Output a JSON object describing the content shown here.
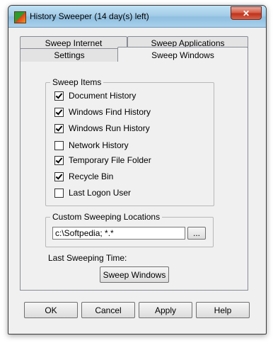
{
  "window": {
    "title": "History Sweeper (14 day(s) left)",
    "close_label": "✕"
  },
  "tabs": {
    "row1": [
      "Sweep Internet",
      "Sweep Applications"
    ],
    "row2": [
      "Settings",
      "Sweep Windows"
    ],
    "active": "Sweep Windows"
  },
  "sweep_items": {
    "legend": "Sweep Items",
    "items": [
      {
        "label": "Document History",
        "checked": true
      },
      {
        "label": "Windows Find History",
        "checked": true
      },
      {
        "label": "Windows Run History",
        "checked": true
      },
      {
        "label": "Network History",
        "checked": false
      },
      {
        "label": "Temporary File Folder",
        "checked": true
      },
      {
        "label": "Recycle Bin",
        "checked": true
      },
      {
        "label": "Last Logon User",
        "checked": false
      }
    ]
  },
  "custom_locations": {
    "legend": "Custom Sweeping Locations",
    "path_value": "c:\\Softpedia; *.*",
    "browse_label": "..."
  },
  "last_sweeping_label": "Last Sweeping Time:",
  "sweep_button_label": "Sweep Windows",
  "footer": {
    "ok": "OK",
    "cancel": "Cancel",
    "apply": "Apply",
    "help": "Help"
  }
}
